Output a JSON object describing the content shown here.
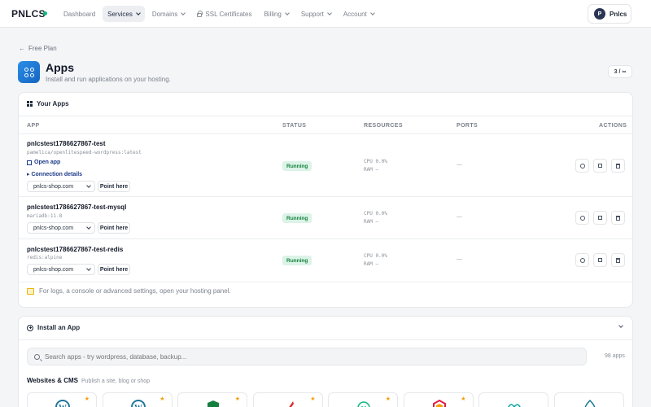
{
  "nav": {
    "logo": "PNLCS",
    "items": [
      {
        "label": "Dashboard"
      },
      {
        "label": "Services"
      },
      {
        "label": "Domains"
      },
      {
        "label": "SSL Certificates"
      },
      {
        "label": "Billing"
      },
      {
        "label": "Support"
      },
      {
        "label": "Account"
      }
    ],
    "user": {
      "initial": "P",
      "name": "Pnlcs"
    }
  },
  "header": {
    "back": "Free Plan",
    "title": "Apps",
    "subtitle": "Install and run applications on your hosting.",
    "counter": "3 / ∞"
  },
  "your_apps": {
    "title": "Your Apps",
    "columns": {
      "app": "APP",
      "status": "STATUS",
      "resources": "RESOURCES",
      "ports": "PORTS",
      "actions": "ACTIONS"
    },
    "rows": [
      {
        "name": "pnlcstest1786627867-test",
        "image": "pamelica/openlitespeed-wordpress:latest",
        "open": "Open app",
        "connection": "▸ Connection details",
        "domain": "pnlcs-shop.com",
        "point": "Point here",
        "status": "Running",
        "cpu": "CPU 0.0%",
        "ram": "RAM —",
        "ports": "—"
      },
      {
        "name": "pnlcstest1786627867-test-mysql",
        "image": "mariadb:11.8",
        "domain": "pnlcs-shop.com",
        "point": "Point here",
        "status": "Running",
        "cpu": "CPU 0.0%",
        "ram": "RAM —",
        "ports": "—"
      },
      {
        "name": "pnlcstest1786627867-test-redis",
        "image": "redis:alpine",
        "domain": "pnlcs-shop.com",
        "point": "Point here",
        "status": "Running",
        "cpu": "CPU 0.0%",
        "ram": "RAM —",
        "ports": "—"
      }
    ],
    "note": "For logs, a console or advanced settings, open your hosting panel."
  },
  "install": {
    "title": "Install an App",
    "search_placeholder": "Search apps - try wordpress, database, backup...",
    "count": "98 apps",
    "category": "Websites & CMS",
    "category_sub": "Publish a site, blog or shop",
    "tiles": [
      {
        "icon": "wordpress-icon",
        "color": "#21759b"
      },
      {
        "icon": "wordpress-icon",
        "color": "#21759b"
      },
      {
        "icon": "shield-icon",
        "color": "#15803d"
      },
      {
        "icon": "feather-icon",
        "color": "#dc2626"
      },
      {
        "icon": "ghost-icon",
        "color": "#10b981"
      },
      {
        "icon": "hexagon-icon",
        "color": "#e11d48"
      },
      {
        "icon": "infinity-icon",
        "color": "#0ea5a4"
      },
      {
        "icon": "drupal-icon",
        "color": "#0e7490"
      }
    ]
  },
  "colors": {
    "accent": "#1565c0",
    "running": "#15803d",
    "running_bg": "#dcf3e7",
    "star": "#f59e0b"
  }
}
